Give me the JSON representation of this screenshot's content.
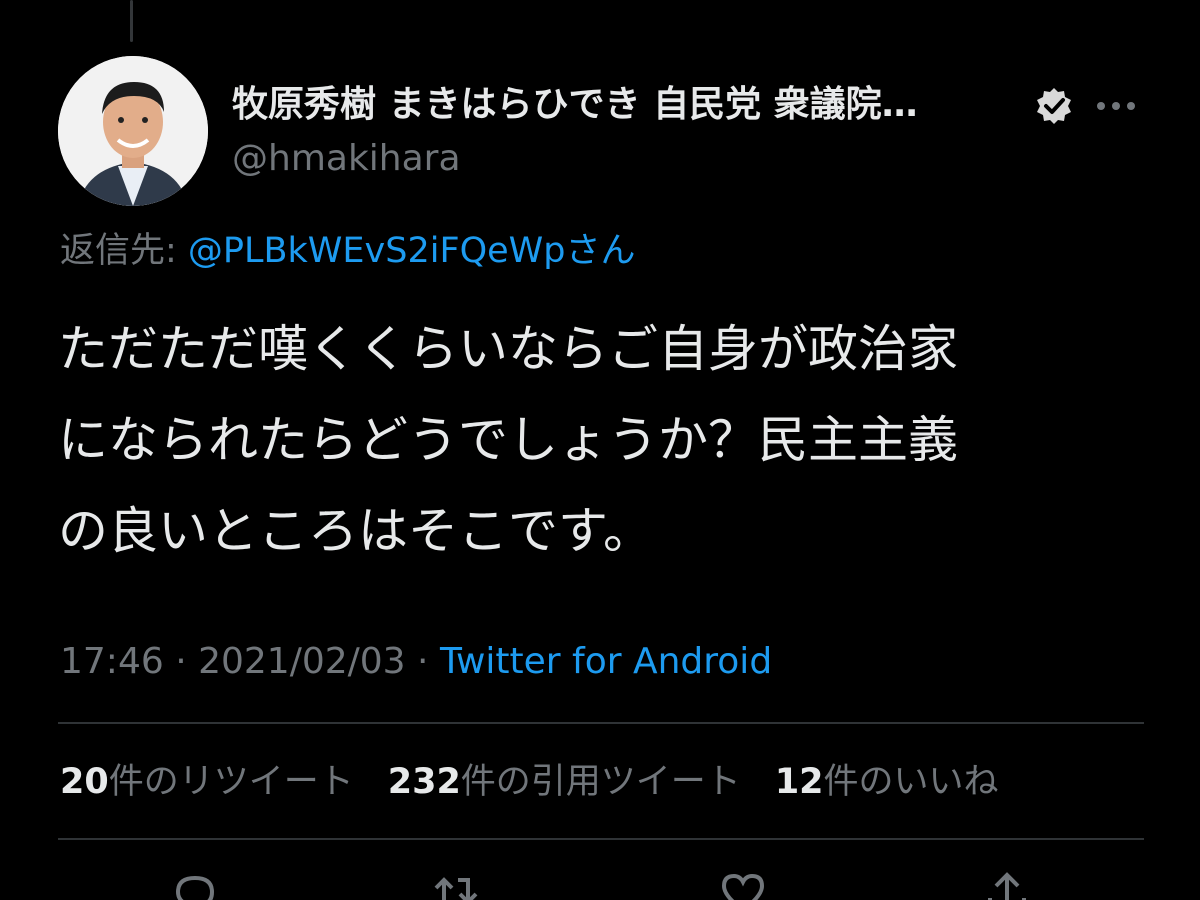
{
  "tweet": {
    "display_name": "牧原秀樹 まきはらひでき 自民党 衆議院…",
    "handle": "@hmakihara",
    "reply_to_label": "返信先: ",
    "reply_to_mention": "@PLBkWEvS2iFQeWpさん",
    "text_lines": [
      "ただただ嘆くくらいならご自身が政治家",
      "になられたらどうでしょうか？民主主義",
      "の良いところはそこです。"
    ],
    "time": "17:46",
    "date": "2021/02/03",
    "separator": " · ",
    "source": "Twitter for Android"
  },
  "stats": {
    "retweets": {
      "count": "20",
      "label": "件のリツイート"
    },
    "quotes": {
      "count": "232",
      "label": "件の引用ツイート"
    },
    "likes": {
      "count": "12",
      "label": "件のいいね"
    }
  },
  "icons": {
    "verified": "verified-badge-icon",
    "more": "more-options-icon",
    "reply": "reply-icon",
    "retweet": "retweet-icon",
    "like": "like-heart-icon",
    "share": "share-icon"
  },
  "colors": {
    "background": "#000000",
    "text": "#e7e9ea",
    "secondary": "#71767b",
    "link": "#1d9bf0",
    "divider": "#2f3336"
  }
}
